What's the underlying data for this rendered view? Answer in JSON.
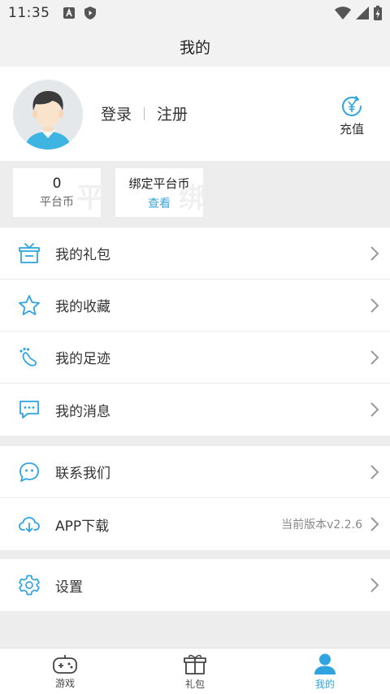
{
  "status_bar": {
    "time": "11:35"
  },
  "header": {
    "title": "我的"
  },
  "profile": {
    "login": "登录",
    "register": "注册",
    "recharge": "充值"
  },
  "coins": {
    "platform_value": "0",
    "platform_label": "平台币",
    "bound_label": "绑定平台币",
    "bound_link": "查看"
  },
  "menu": {
    "gift": "我的礼包",
    "favorites": "我的收藏",
    "footprints": "我的足迹",
    "messages": "我的消息",
    "contact": "联系我们",
    "app_download": "APP下载",
    "version": "当前版本v2.2.6",
    "settings": "设置"
  },
  "tabs": {
    "games": "游戏",
    "gifts": "礼包",
    "mine": "我的"
  },
  "colors": {
    "accent": "#2fa4e0",
    "background": "#ededed"
  }
}
